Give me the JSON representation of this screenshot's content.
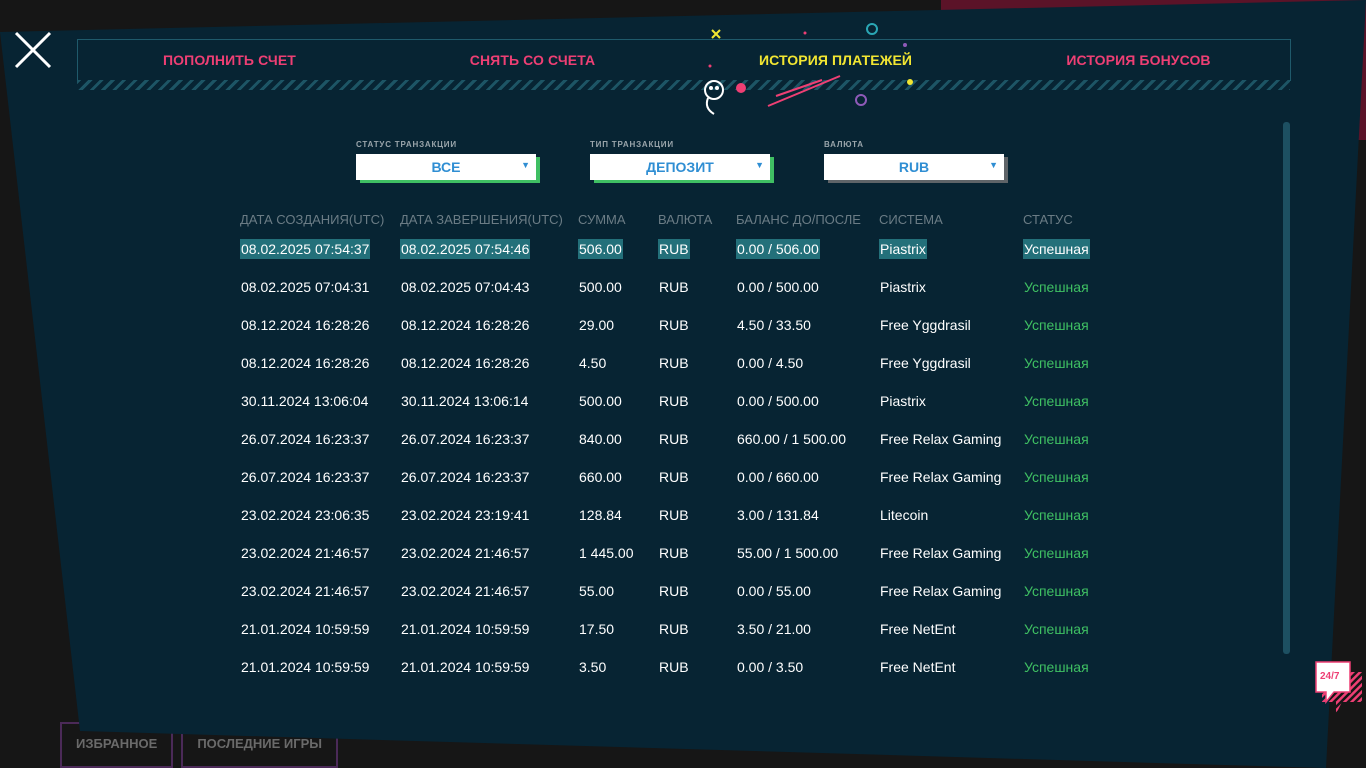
{
  "background": {
    "tabs": [
      "ИЗБРАННОЕ",
      "ПОСЛЕДНИЕ ИГРЫ"
    ]
  },
  "tabs": [
    {
      "label": "ПОПОЛНИТЬ СЧЕТ",
      "active": false
    },
    {
      "label": "СНЯТЬ СО СЧЕТА",
      "active": false
    },
    {
      "label": "ИСТОРИЯ ПЛАТЕЖЕЙ",
      "active": true
    },
    {
      "label": "ИСТОРИЯ БОНУСОВ",
      "active": false
    }
  ],
  "filters": {
    "status": {
      "label": "СТАТУС ТРАНЗАКЦИИ",
      "value": "ВСЕ"
    },
    "type": {
      "label": "ТИП ТРАНЗАКЦИИ",
      "value": "ДЕПОЗИТ"
    },
    "currency": {
      "label": "ВАЛЮТА",
      "value": "RUB"
    }
  },
  "table": {
    "headers": [
      "ДАТА СОЗДАНИЯ(UTC)",
      "ДАТА ЗАВЕРШЕНИЯ(UTC)",
      "СУММА",
      "ВАЛЮТА",
      "БАЛАНС ДО/ПОСЛЕ",
      "СИСТЕМА",
      "СТАТУС"
    ],
    "rows": [
      [
        "08.02.2025 07:54:37",
        "08.02.2025 07:54:46",
        "506.00",
        "RUB",
        "0.00 / 506.00",
        "Piastrix",
        "Успешная"
      ],
      [
        "08.02.2025 07:04:31",
        "08.02.2025 07:04:43",
        "500.00",
        "RUB",
        "0.00 / 500.00",
        "Piastrix",
        "Успешная"
      ],
      [
        "08.12.2024 16:28:26",
        "08.12.2024 16:28:26",
        "29.00",
        "RUB",
        "4.50 / 33.50",
        "Free Yggdrasil",
        "Успешная"
      ],
      [
        "08.12.2024 16:28:26",
        "08.12.2024 16:28:26",
        "4.50",
        "RUB",
        "0.00 / 4.50",
        "Free Yggdrasil",
        "Успешная"
      ],
      [
        "30.11.2024 13:06:04",
        "30.11.2024 13:06:14",
        "500.00",
        "RUB",
        "0.00 / 500.00",
        "Piastrix",
        "Успешная"
      ],
      [
        "26.07.2024 16:23:37",
        "26.07.2024 16:23:37",
        "840.00",
        "RUB",
        "660.00 / 1 500.00",
        "Free Relax Gaming",
        "Успешная"
      ],
      [
        "26.07.2024 16:23:37",
        "26.07.2024 16:23:37",
        "660.00",
        "RUB",
        "0.00 / 660.00",
        "Free Relax Gaming",
        "Успешная"
      ],
      [
        "23.02.2024 23:06:35",
        "23.02.2024 23:19:41",
        "128.84",
        "RUB",
        "3.00 / 131.84",
        "Litecoin",
        "Успешная"
      ],
      [
        "23.02.2024 21:46:57",
        "23.02.2024 21:46:57",
        "1 445.00",
        "RUB",
        "55.00 / 1 500.00",
        "Free Relax Gaming",
        "Успешная"
      ],
      [
        "23.02.2024 21:46:57",
        "23.02.2024 21:46:57",
        "55.00",
        "RUB",
        "0.00 / 55.00",
        "Free Relax Gaming",
        "Успешная"
      ],
      [
        "21.01.2024 10:59:59",
        "21.01.2024 10:59:59",
        "17.50",
        "RUB",
        "3.50 / 21.00",
        "Free NetEnt",
        "Успешная"
      ],
      [
        "21.01.2024 10:59:59",
        "21.01.2024 10:59:59",
        "3.50",
        "RUB",
        "0.00 / 3.50",
        "Free NetEnt",
        "Успешная"
      ]
    ]
  },
  "chat": {
    "label": "24/7"
  },
  "colors": {
    "panel": "#072433",
    "tab": "#ee3f74",
    "tab_active": "#f2e632",
    "status_success": "#3fc063",
    "select_text": "#2f8ed3"
  }
}
